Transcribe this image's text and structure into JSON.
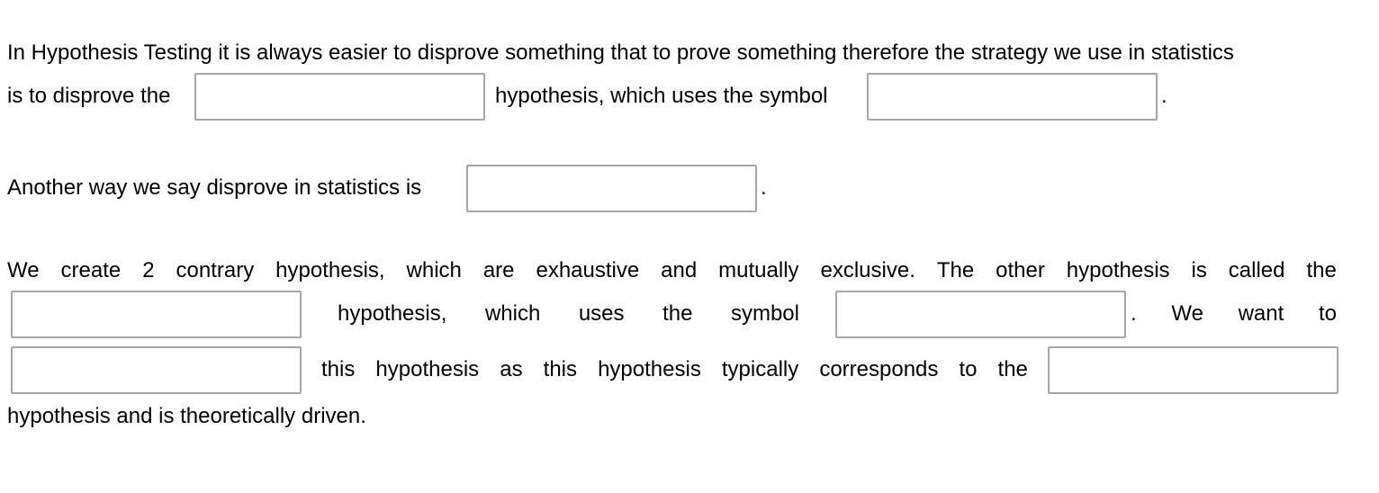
{
  "paragraph1": {
    "line1": "In Hypothesis Testing it is always easier to disprove something that to prove something therefore the strategy we use in statistics",
    "line2_before": "is to disprove the",
    "line2_middle": "hypothesis, which uses the symbol",
    "line2_end": ".",
    "blanks": [
      {
        "value": "",
        "placeholder": ""
      },
      {
        "value": "",
        "placeholder": ""
      }
    ]
  },
  "paragraph2": {
    "before": "Another way we say disprove in statistics is",
    "end": ".",
    "blanks": [
      {
        "value": "",
        "placeholder": ""
      }
    ]
  },
  "paragraph3": {
    "line1_words": [
      "We",
      "create",
      "2",
      "contrary",
      "hypothesis,",
      "which",
      "are",
      "exhaustive",
      "and",
      "mutually",
      "exclusive.",
      "The",
      "other",
      "hypothesis",
      "is",
      "called",
      "the"
    ],
    "line2_words": [
      "hypothesis,",
      "which",
      "uses",
      "the",
      "symbol"
    ],
    "line2_end_words": [
      ".",
      "We",
      "want",
      "to"
    ],
    "line3_words": [
      "this",
      "hypothesis",
      "as",
      "this",
      "hypothesis",
      "typically",
      "corresponds",
      "to",
      "the"
    ],
    "line4": "hypothesis and is theoretically driven.",
    "blanks": [
      {
        "value": "",
        "placeholder": ""
      },
      {
        "value": "",
        "placeholder": ""
      },
      {
        "value": "",
        "placeholder": ""
      },
      {
        "value": "",
        "placeholder": ""
      }
    ]
  }
}
